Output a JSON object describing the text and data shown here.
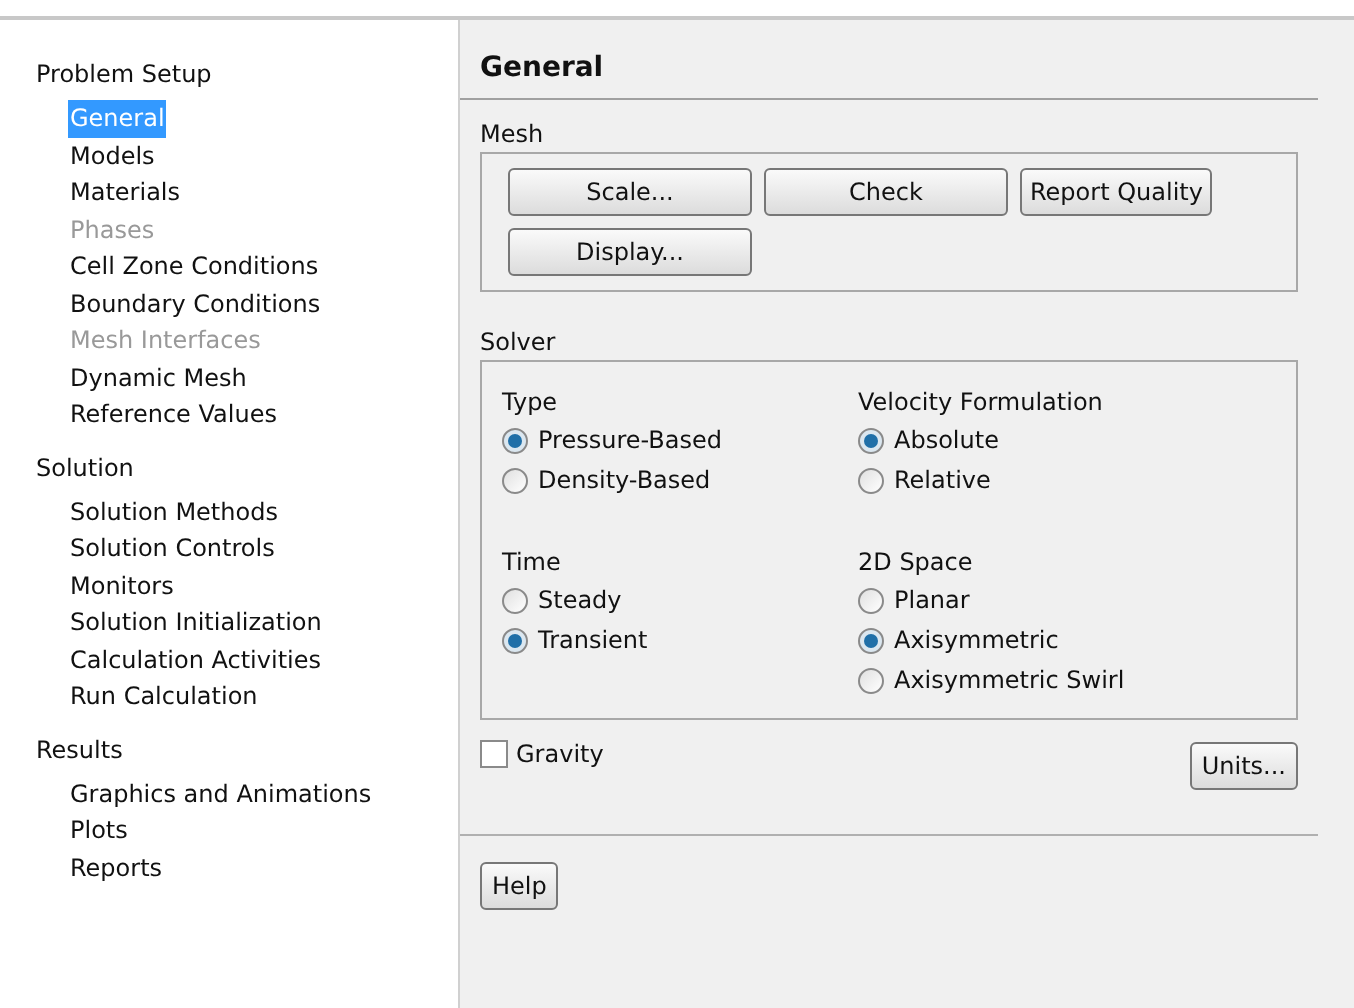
{
  "sidebar": {
    "sections": [
      {
        "label": "Problem Setup",
        "items": [
          {
            "label": "General",
            "selected": true,
            "disabled": false
          },
          {
            "label": "Models",
            "selected": false,
            "disabled": false
          },
          {
            "label": "Materials",
            "selected": false,
            "disabled": false
          },
          {
            "label": "Phases",
            "selected": false,
            "disabled": true
          },
          {
            "label": "Cell Zone Conditions",
            "selected": false,
            "disabled": false
          },
          {
            "label": "Boundary Conditions",
            "selected": false,
            "disabled": false
          },
          {
            "label": "Mesh Interfaces",
            "selected": false,
            "disabled": true
          },
          {
            "label": "Dynamic Mesh",
            "selected": false,
            "disabled": false
          },
          {
            "label": "Reference Values",
            "selected": false,
            "disabled": false
          }
        ]
      },
      {
        "label": "Solution",
        "items": [
          {
            "label": "Solution Methods",
            "selected": false,
            "disabled": false
          },
          {
            "label": "Solution Controls",
            "selected": false,
            "disabled": false
          },
          {
            "label": "Monitors",
            "selected": false,
            "disabled": false
          },
          {
            "label": "Solution Initialization",
            "selected": false,
            "disabled": false
          },
          {
            "label": "Calculation Activities",
            "selected": false,
            "disabled": false
          },
          {
            "label": "Run Calculation",
            "selected": false,
            "disabled": false
          }
        ]
      },
      {
        "label": "Results",
        "items": [
          {
            "label": "Graphics and Animations",
            "selected": false,
            "disabled": false
          },
          {
            "label": "Plots",
            "selected": false,
            "disabled": false
          },
          {
            "label": "Reports",
            "selected": false,
            "disabled": false
          }
        ]
      }
    ]
  },
  "panel": {
    "title": "General",
    "mesh": {
      "label": "Mesh",
      "buttons": [
        [
          "Scale...",
          "Check",
          "Report Quality"
        ],
        [
          "Display..."
        ]
      ]
    },
    "solver": {
      "label": "Solver",
      "groups": [
        {
          "label": "Type",
          "options": [
            {
              "label": "Pressure-Based",
              "selected": true
            },
            {
              "label": "Density-Based",
              "selected": false
            }
          ]
        },
        {
          "label": "Velocity Formulation",
          "options": [
            {
              "label": "Absolute",
              "selected": true
            },
            {
              "label": "Relative",
              "selected": false
            }
          ]
        },
        {
          "label": "Time",
          "options": [
            {
              "label": "Steady",
              "selected": false
            },
            {
              "label": "Transient",
              "selected": true
            }
          ]
        },
        {
          "label": "2D Space",
          "options": [
            {
              "label": "Planar",
              "selected": false
            },
            {
              "label": "Axisymmetric",
              "selected": true
            },
            {
              "label": "Axisymmetric Swirl",
              "selected": false
            }
          ]
        }
      ]
    },
    "gravity": {
      "label": "Gravity",
      "checked": false
    },
    "units_button": "Units...",
    "help_button": "Help"
  }
}
